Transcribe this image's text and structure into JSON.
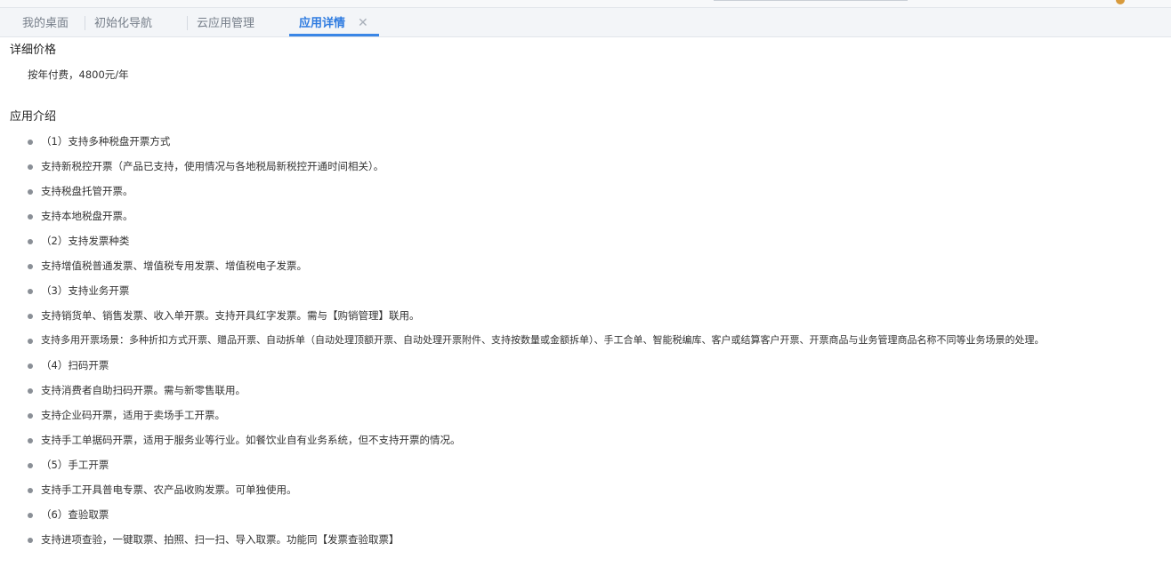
{
  "tabs": [
    {
      "label": "我的桌面",
      "active": false
    },
    {
      "label": "初始化导航",
      "active": false
    },
    {
      "label": "云应用管理",
      "active": false
    },
    {
      "label": "应用详情",
      "active": true,
      "close": "✕"
    }
  ],
  "price": {
    "title": "详细价格",
    "text": "按年付费，4800元/年"
  },
  "intro": {
    "title": "应用介绍",
    "items": [
      "（1）支持多种税盘开票方式",
      "支持新税控开票（产品已支持，使用情况与各地税局新税控开通时间相关）。",
      "支持税盘托管开票。",
      "支持本地税盘开票。",
      "（2）支持发票种类",
      "支持增值税普通发票、增值税专用发票、增值税电子发票。",
      "（3）支持业务开票",
      "支持销货单、销售发票、收入单开票。支持开具红字发票。需与【购销管理】联用。",
      "支持多用开票场景：多种折扣方式开票、赠品开票、自动拆单（自动处理顶额开票、自动处理开票附件、支持按数量或金额拆单）、手工合单、智能税编库、客户或结算客户开票、开票商品与业务管理商品名称不同等业务场景的处理。",
      "（4）扫码开票",
      "支持消费者自助扫码开票。需与新零售联用。",
      "支持企业码开票，适用于卖场手工开票。",
      "支持手工单据码开票，适用于服务业等行业。如餐饮业自有业务系统，但不支持开票的情况。",
      "（5）手工开票",
      "支持手工开具普电专票、农产品收购发票。可单独使用。",
      "（6）查验取票",
      "支持进项查验，一键取票、拍照、扫一扫、导入取票。功能同【发票查验取票】"
    ]
  }
}
